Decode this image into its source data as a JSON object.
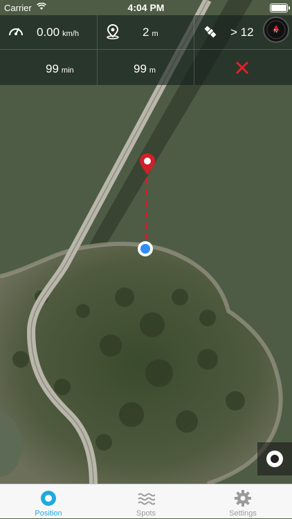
{
  "status_bar": {
    "carrier": "Carrier",
    "time": "4:04 PM"
  },
  "metrics": {
    "speed": {
      "value": "0.00",
      "unit": "km/h"
    },
    "accuracy": {
      "value": "2",
      "unit": "m"
    },
    "satellites": {
      "value": "> 12"
    },
    "time_to_target": {
      "value": "99",
      "unit": "min"
    },
    "distance_to_target": {
      "value": "99",
      "unit": "m"
    }
  },
  "compass": {
    "heading_label": "N"
  },
  "tabs": [
    {
      "label": "Position",
      "icon": "position-icon",
      "active": true
    },
    {
      "label": "Spots",
      "icon": "waves-icon",
      "active": false
    },
    {
      "label": "Settings",
      "icon": "gear-icon",
      "active": false
    }
  ],
  "colors": {
    "accent": "#1ea9e1",
    "marker": "#d0202a",
    "location_dot": "#2f8ef7"
  }
}
